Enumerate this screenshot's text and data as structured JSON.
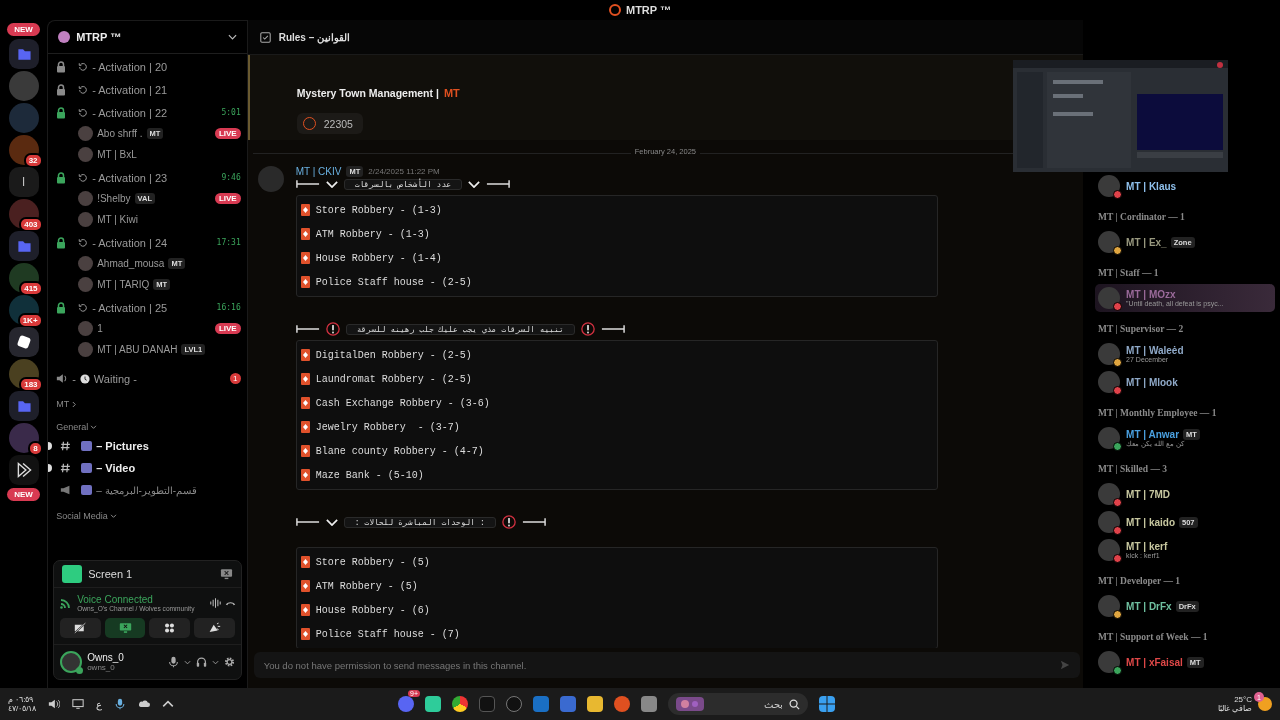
{
  "window": {
    "title": "MTRP ™"
  },
  "servers": [
    {
      "kind": "new",
      "badge": "NEW"
    },
    {
      "kind": "folder"
    },
    {
      "kind": "avatar",
      "color": "#3a3a3a"
    },
    {
      "kind": "avatar",
      "color": "#1d2a3a"
    },
    {
      "kind": "avatar",
      "color": "#5a2a10",
      "badge": "32"
    },
    {
      "kind": "letter",
      "letter": "l"
    },
    {
      "kind": "avatar",
      "color": "#4a2020",
      "badge": "403"
    },
    {
      "kind": "folder"
    },
    {
      "kind": "avatar",
      "color": "#1f3a22",
      "badge": "415"
    },
    {
      "kind": "avatar",
      "color": "#10303a",
      "badge": "1K+"
    },
    {
      "kind": "dice"
    },
    {
      "kind": "avatar",
      "color": "#4a4020",
      "badge": "183"
    },
    {
      "kind": "folder"
    },
    {
      "kind": "avatar",
      "color": "#3a2a4a",
      "badge": "8"
    },
    {
      "kind": "play"
    },
    {
      "kind": "new",
      "badge": "NEW"
    }
  ],
  "server_name": "MTRP ™",
  "channels": [
    {
      "kind": "voice",
      "name": "- Activation | 20",
      "locked": true
    },
    {
      "kind": "voice",
      "name": "- Activation | 21",
      "locked": true
    },
    {
      "kind": "voice",
      "name": "- Activation | 22",
      "locked": false,
      "timer": "5:01"
    },
    {
      "kind": "user",
      "name": "Abo shrff .",
      "tag": "MT",
      "live": "LIVE"
    },
    {
      "kind": "user",
      "name": "MT | BxL"
    },
    {
      "kind": "voice",
      "name": "- Activation | 23",
      "locked": false,
      "timer": "9:46"
    },
    {
      "kind": "user",
      "name": "!Shelby",
      "tag": "VAL",
      "live": "LIVE"
    },
    {
      "kind": "user",
      "name": "MT | Kiwi"
    },
    {
      "kind": "voice",
      "name": "- Activation | 24",
      "locked": false,
      "timer": "17:31"
    },
    {
      "kind": "user",
      "name": "Ahmad_mousa",
      "tag": "MT"
    },
    {
      "kind": "user",
      "name": "MT | TARIQ",
      "tag": "MT"
    },
    {
      "kind": "voice",
      "name": "- Activation | 25",
      "locked": false,
      "timer": "16:16"
    },
    {
      "kind": "user",
      "name": "1",
      "live": "LIVE"
    },
    {
      "kind": "user",
      "name": "MT | ABU DANAH",
      "tag": "LVL1"
    },
    {
      "kind": "stage",
      "prefix": "-",
      "name": "Waiting -",
      "count": "1"
    },
    {
      "kind": "category",
      "name": "MT",
      "expanded": false
    },
    {
      "kind": "category",
      "name": "General",
      "expanded": true
    },
    {
      "kind": "text",
      "name": "– Pictures",
      "unread": true
    },
    {
      "kind": "text",
      "name": "– Video",
      "unread": true
    },
    {
      "kind": "announce",
      "name": "– قسم-التطوير-البرمجية",
      "unread": false
    },
    {
      "kind": "category",
      "name": "Social Media",
      "expanded": true
    }
  ],
  "stream": {
    "title": "Screen 1"
  },
  "voice": {
    "status": "Voice Connected",
    "channel": "Owns_O's Channel / Wolves community",
    "buttons": [
      {
        "kind": "camera",
        "on": false
      },
      {
        "kind": "screen",
        "on": true
      },
      {
        "kind": "activity",
        "on": false
      },
      {
        "kind": "soundboard",
        "on": false
      }
    ]
  },
  "user": {
    "name": "Owns_0",
    "handle": "owns_0"
  },
  "channel_header": {
    "name": "Rules – القوانين"
  },
  "embed": {
    "title": "Mystery Town Management |",
    "logo": "MT",
    "reaction_count": "22305"
  },
  "date_divider": "February 24, 2025",
  "message": {
    "author": "MT | CKIV",
    "tag": "MT",
    "time": "2/24/2025 11:22 PM",
    "sections": [
      {
        "heading": "عدد الأشخاص بالسرقات",
        "left_icon": {
          "kind": "chevron"
        },
        "right_icon": {
          "kind": "chevron"
        },
        "lines": [
          "Store Robbery - (1-3)",
          "ATM Robbery - (1-3)",
          "House Robbery - (1-4)",
          "Police Staff house - (2-5)"
        ]
      },
      {
        "heading": "تنبيه السرقات مذي يجب عليك جلب رهينه للسرقة",
        "left_icon": {
          "kind": "alert"
        },
        "right_icon": {
          "kind": "alert"
        },
        "lines": [
          "DigitalDen Robbery - (2-5)",
          "Laundromat Robbery - (2-5)",
          "Cash Exchange Robbery - (3-6)",
          "Jewelry Robbery  - (3-7)",
          "Blane county Robbery - (4-7)",
          "Maze Bank - (5-10)"
        ]
      },
      {
        "heading": ": الوحدات المباشرة للحالات :",
        "left_icon": {
          "kind": "chevron"
        },
        "right_icon": {
          "kind": "alert"
        },
        "lines": [
          "Store Robbery - (5)",
          "ATM Robbery - (5)",
          "House Robbery - (6)",
          "Police Staff house - (7)"
        ]
      }
    ]
  },
  "composer": {
    "placeholder": "You do not have permission to send messages in this channel."
  },
  "members": [
    {
      "kind": "member",
      "name": "MT | Klaus",
      "color": "#8fc0ec",
      "status": {
        "kind": "dnd"
      }
    },
    {
      "kind": "group",
      "name": "MT | Cordinator — 1"
    },
    {
      "kind": "member",
      "name": "MT | Ex_",
      "color": "#9a9a80",
      "status": {
        "kind": "idle"
      },
      "tag": "Zone"
    },
    {
      "kind": "group",
      "name": "MT | Staff — 1"
    },
    {
      "kind": "member",
      "name": "MT | MOzx",
      "color": "#9a6a9a",
      "status": {
        "kind": "dnd"
      },
      "subtitle": "\"Until death, all defeat is psyc...",
      "highlight": true
    },
    {
      "kind": "group",
      "name": "MT | Supervisor — 2"
    },
    {
      "kind": "member",
      "name": "MT | Waleėd",
      "color": "#8fa9c8",
      "status": {
        "kind": "idle"
      },
      "subtitle": "27 December"
    },
    {
      "kind": "member",
      "name": "MT | Mlook",
      "color": "#8fa9c8",
      "status": {
        "kind": "dnd"
      }
    },
    {
      "kind": "group",
      "name": "MT | Monthly Employee — 1"
    },
    {
      "kind": "member",
      "name": "MT | Anwar",
      "color": "#4aa0e0",
      "status": {
        "kind": "online"
      },
      "tag": "MT",
      "subtitle": "كن مع الله يكن معك"
    },
    {
      "kind": "group",
      "name": "MT | Skilled — 3"
    },
    {
      "kind": "member",
      "name": "MT | 7MD",
      "color": "#c8c8a0",
      "status": {
        "kind": "dnd"
      }
    },
    {
      "kind": "member",
      "name": "MT | kaido",
      "color": "#c8c8a0",
      "status": {
        "kind": "dnd"
      },
      "tag": "507"
    },
    {
      "kind": "member",
      "name": "MT | kerf",
      "color": "#c8c8a0",
      "status": {
        "kind": "dnd"
      },
      "subtitle": "kick : kerf1"
    },
    {
      "kind": "group",
      "name": "MT | Developer — 1"
    },
    {
      "kind": "member",
      "name": "MT | DrFx",
      "color": "#6fc0a0",
      "status": {
        "kind": "idle"
      },
      "tag": "DrFx"
    },
    {
      "kind": "group",
      "name": "MT | Support of Week — 1"
    },
    {
      "kind": "member",
      "name": "MT | xFaisal",
      "color": "#e04848",
      "status": {
        "kind": "online"
      },
      "tag": "MT"
    }
  ],
  "taskbar": {
    "time": "٠٦:٥٩ م",
    "date": "٤٧/٠٥/١٨",
    "language": "ع",
    "search": "بحث",
    "app_badge": "9+",
    "temperature": "25°C",
    "weather": "صافي غالبًا",
    "weather_badge": "1"
  }
}
